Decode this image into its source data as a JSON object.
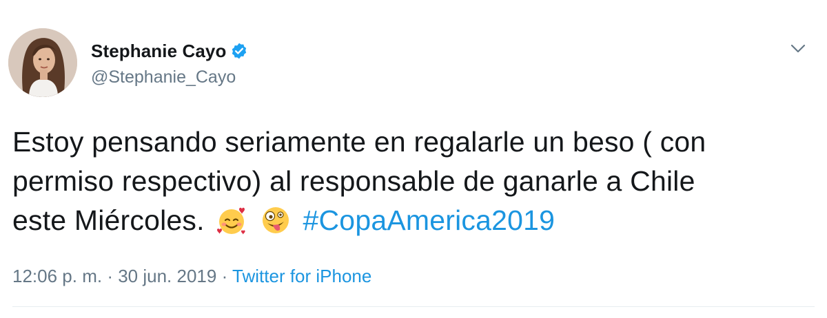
{
  "tweet": {
    "author": {
      "display_name": "Stephanie Cayo",
      "handle": "@Stephanie_Cayo",
      "verified": true,
      "avatar_icon": "profile-photo"
    },
    "text": {
      "line1": "Estoy pensando seriamente en regalarle un beso ( con",
      "line2": "permiso respectivo) al responsable de ganarle a Chile",
      "line3": "este Miércoles.",
      "emojis": [
        "smiling-face-with-hearts-emoji",
        "zany-face-emoji"
      ],
      "hashtag": "#CopaAmerica2019"
    },
    "meta": {
      "time": "12:06 p. m.",
      "separator": "·",
      "date": "30 jun. 2019",
      "source": "Twitter for iPhone"
    },
    "menu_icon": "chevron-down-icon"
  },
  "colors": {
    "text": "#14171a",
    "secondary": "#657786",
    "link": "#1b95e0",
    "verified": "#1da1f2",
    "divider": "#e6ecf0"
  }
}
